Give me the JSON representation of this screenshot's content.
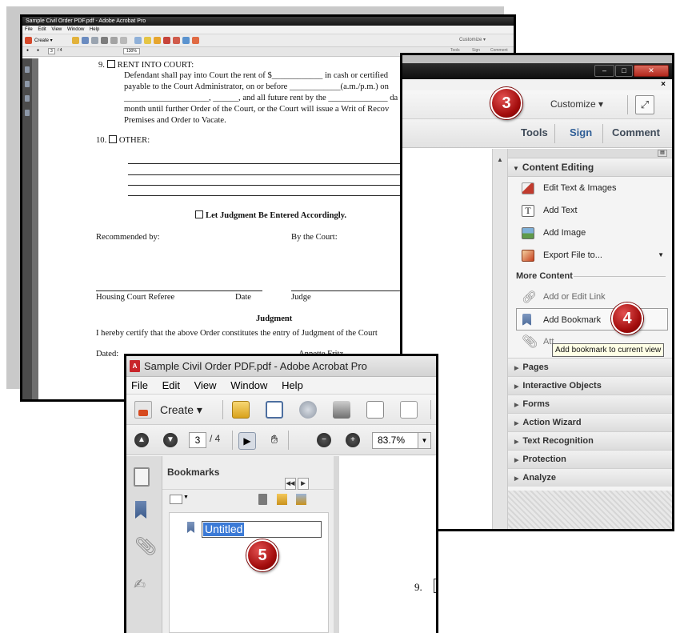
{
  "docWindow": {
    "title": "Sample Civil Order PDF.pdf - Adobe Acrobat Pro",
    "menu": [
      "File",
      "Edit",
      "View",
      "Window",
      "Help"
    ],
    "create_label": "Create",
    "customize_label": "Customize",
    "page_num": "3",
    "page_total": "/ 4",
    "zoom": "130%",
    "pane_tabs": [
      "Tools",
      "Sign",
      "Comment"
    ],
    "lines": {
      "l9": "9.",
      "l9title": "RENT INTO COURT:",
      "l9a": "Defendant shall pay into Court the rent of $____________ in cash or certified",
      "l9b": "payable to the Court Administrator, on or before ____________(a.m./p.m.) on",
      "l9c": "____________________, ______, and all future rent by the ______________ da",
      "l9d": "month until further Order of the Court, or the Court will issue a Writ of Recov",
      "l9e": "Premises and Order to Vacate.",
      "l10": "10.",
      "l10title": "OTHER:",
      "judgment_check": "Let Judgment Be Entered Accordingly.",
      "recommended": "Recommended by:",
      "bycourt": "By the Court:",
      "referee": "Housing Court Referee",
      "date": "Date",
      "judge": "Judge",
      "judgment_head": "Judgment",
      "certify": "I hereby certify that the above Order constitutes the entry of Judgment of the Court",
      "dated": "Dated:",
      "signer": "Annette Fritz"
    }
  },
  "toolsPane": {
    "customize_label": "Customize",
    "tabs": [
      "Tools",
      "Sign",
      "Comment"
    ],
    "content_editing": "Content Editing",
    "items": [
      "Edit Text & Images",
      "Add Text",
      "Add Image",
      "Export File to..."
    ],
    "more_content": "More Content",
    "more_items": [
      "Add or Edit Link",
      "Add Bookmark",
      "Att"
    ],
    "tooltip": "Add bookmark to current view",
    "sections": [
      "Pages",
      "Interactive Objects",
      "Forms",
      "Action Wizard",
      "Text Recognition",
      "Protection",
      "Analyze"
    ]
  },
  "bookmarkWindow": {
    "title": "Sample Civil Order PDF.pdf - Adobe Acrobat Pro",
    "menu": [
      "File",
      "Edit",
      "View",
      "Window",
      "Help"
    ],
    "create_label": "Create",
    "page_num": "3",
    "page_total": "/ 4",
    "zoom": "83.7%",
    "bookmarks_label": "Bookmarks",
    "new_bookmark": "Untitled",
    "doc_fragment": "9."
  },
  "callouts": [
    "3",
    "4",
    "5"
  ],
  "colors": {
    "badge": "#b01414",
    "highlight": "#3b7ad6",
    "titlebar_dark": "#151515"
  }
}
